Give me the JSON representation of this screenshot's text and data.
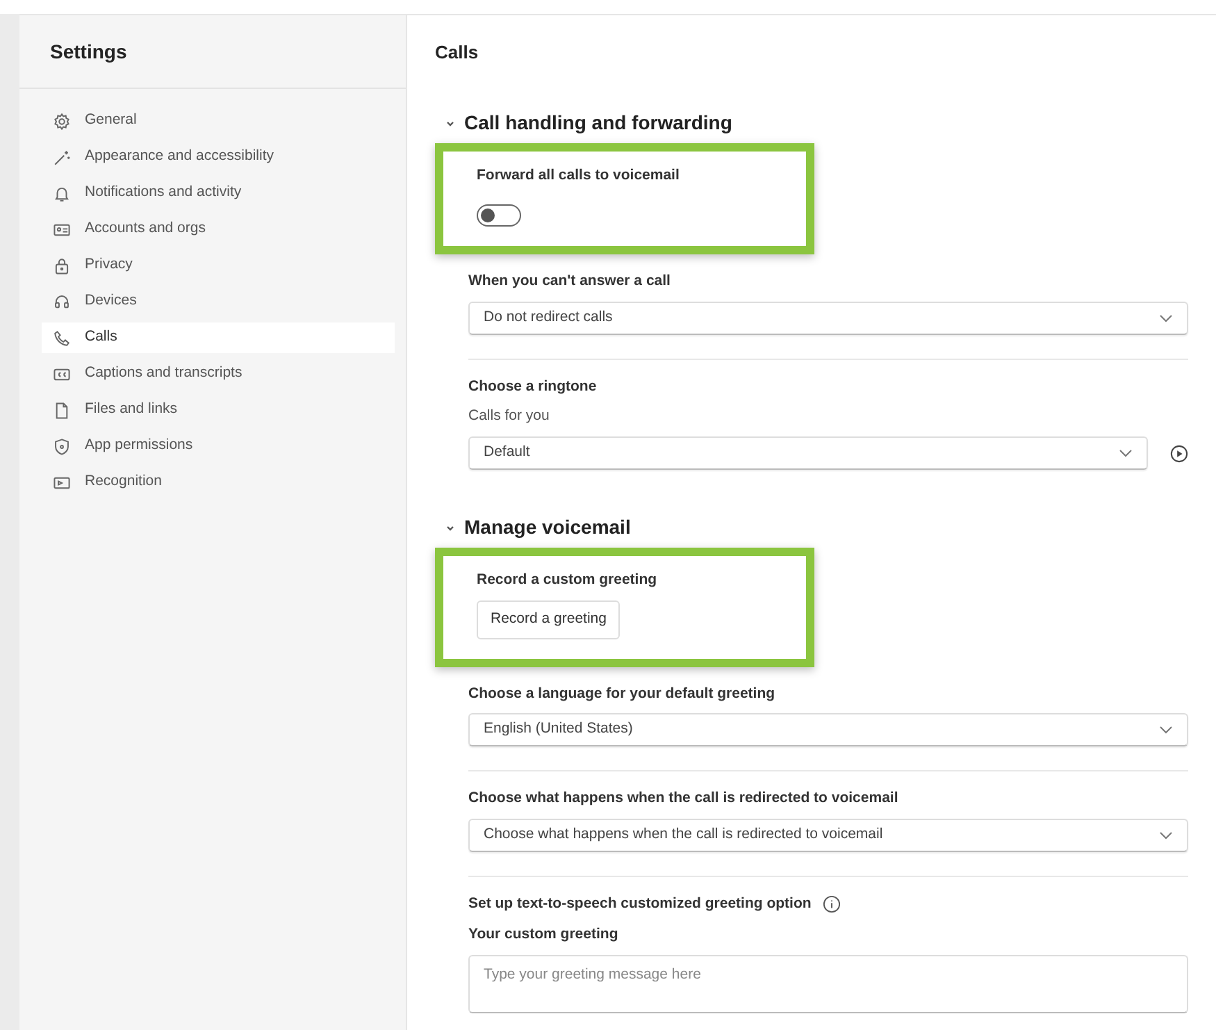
{
  "sidebar": {
    "title": "Settings",
    "items": [
      {
        "label": "General",
        "selected": false
      },
      {
        "label": "Appearance and accessibility",
        "selected": false
      },
      {
        "label": "Notifications and activity",
        "selected": false
      },
      {
        "label": "Accounts and orgs",
        "selected": false
      },
      {
        "label": "Privacy",
        "selected": false
      },
      {
        "label": "Devices",
        "selected": false
      },
      {
        "label": "Calls",
        "selected": true
      },
      {
        "label": "Captions and transcripts",
        "selected": false
      },
      {
        "label": "Files and links",
        "selected": false
      },
      {
        "label": "App permissions",
        "selected": false
      },
      {
        "label": "Recognition",
        "selected": false
      }
    ]
  },
  "main": {
    "title": "Calls",
    "sections": [
      {
        "title": "Call handling and forwarding",
        "expanded": true,
        "settings": [
          {
            "kind": "toggle",
            "label": "Forward all calls to voicemail",
            "on": false,
            "highlighted": true
          },
          {
            "kind": "dropdown",
            "label": "When you can't answer a call",
            "value": "Do not redirect calls",
            "highlighted": false
          },
          {
            "kind": "ringtone",
            "label": "Choose a ringtone",
            "sublabel": "Calls for you",
            "value": "Default",
            "highlighted": false
          }
        ]
      },
      {
        "title": "Manage voicemail",
        "expanded": true,
        "settings": [
          {
            "kind": "button",
            "label": "Record a custom greeting",
            "button": "Record a greeting",
            "highlighted": true
          },
          {
            "kind": "dropdown",
            "label": "Choose a language for your default greeting",
            "value": "English (United States)",
            "highlighted": false
          },
          {
            "kind": "dropdown",
            "label": "Choose what happens when the call is redirected to voicemail",
            "value": "Choose what happens when the call is redirected to voicemail",
            "highlighted": false
          },
          {
            "kind": "textarea",
            "label": "Set up text-to-speech customized greeting option",
            "sublabel": "Your custom greeting",
            "placeholder": "Type your greeting message here",
            "highlighted": false
          }
        ]
      }
    ]
  }
}
